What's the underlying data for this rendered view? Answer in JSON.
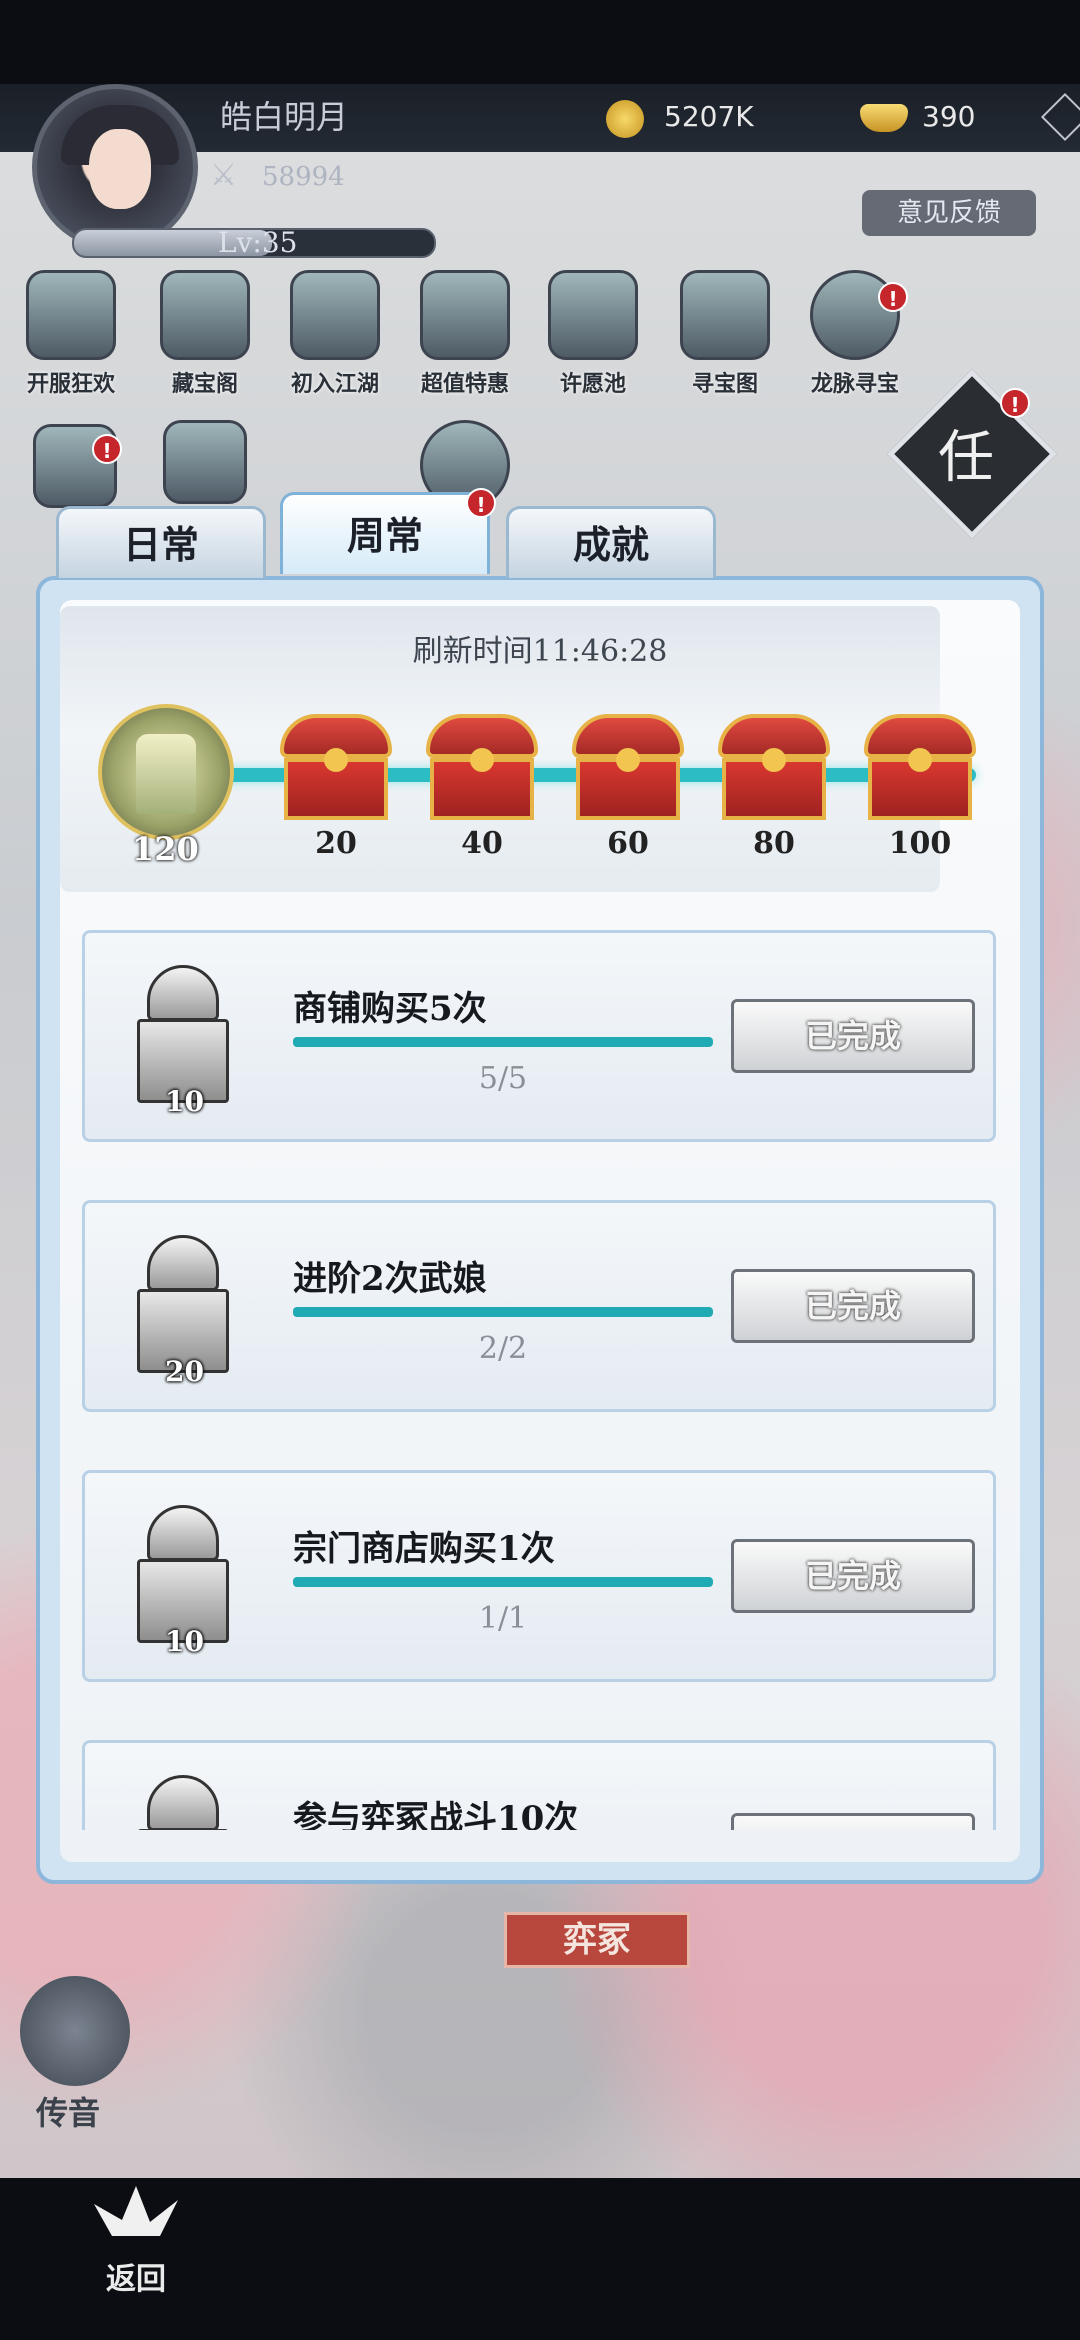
{
  "player": {
    "name": "皓白明月",
    "power": "58994",
    "level": "Lv:35"
  },
  "resources": {
    "coins": "5207K",
    "ingots": "390"
  },
  "feedback_label": "意见反馈",
  "features": [
    {
      "label": "开服狂欢",
      "icon": "scroll-icon",
      "badge": false
    },
    {
      "label": "藏宝阁",
      "icon": "pavilion-icon",
      "badge": false
    },
    {
      "label": "初入江湖",
      "icon": "taiji-chest-icon",
      "badge": false
    },
    {
      "label": "超值特惠",
      "icon": "gold-treasure-icon",
      "badge": false
    },
    {
      "label": "许愿池",
      "icon": "wishing-pool-icon",
      "badge": false
    },
    {
      "label": "寻宝图",
      "icon": "treasure-map-icon",
      "badge": false
    },
    {
      "label": "龙脉寻宝",
      "icon": "compass-icon",
      "badge": true
    }
  ],
  "second_row_labels": [
    "任"
  ],
  "quest_button": {
    "label": "任",
    "badge": "!"
  },
  "tabs": [
    {
      "label": "日常",
      "active": false
    },
    {
      "label": "周常",
      "active": true
    },
    {
      "label": "成就",
      "active": false
    }
  ],
  "tab_badge": "!",
  "refresh_time": "刷新时间11:46:28",
  "points": "120",
  "milestones": [
    "20",
    "40",
    "60",
    "80",
    "100"
  ],
  "tasks": [
    {
      "title": "商铺购买5次",
      "progress": "5/5",
      "reward": "10",
      "status": "已完成"
    },
    {
      "title": "进阶2次武娘",
      "progress": "2/2",
      "reward": "20",
      "status": "已完成"
    },
    {
      "title": "宗门商店购买1次",
      "progress": "1/1",
      "reward": "10",
      "status": "已完成"
    },
    {
      "title": "参与弈冢战斗10次",
      "progress": "",
      "reward": "",
      "status": ""
    }
  ],
  "location_banner": "弈冢",
  "sound_label": "传音",
  "back_label": "返回",
  "colors": {
    "accent_teal": "#2bbcc4",
    "badge_red": "#c4262c",
    "banner_red": "#b8473e"
  }
}
